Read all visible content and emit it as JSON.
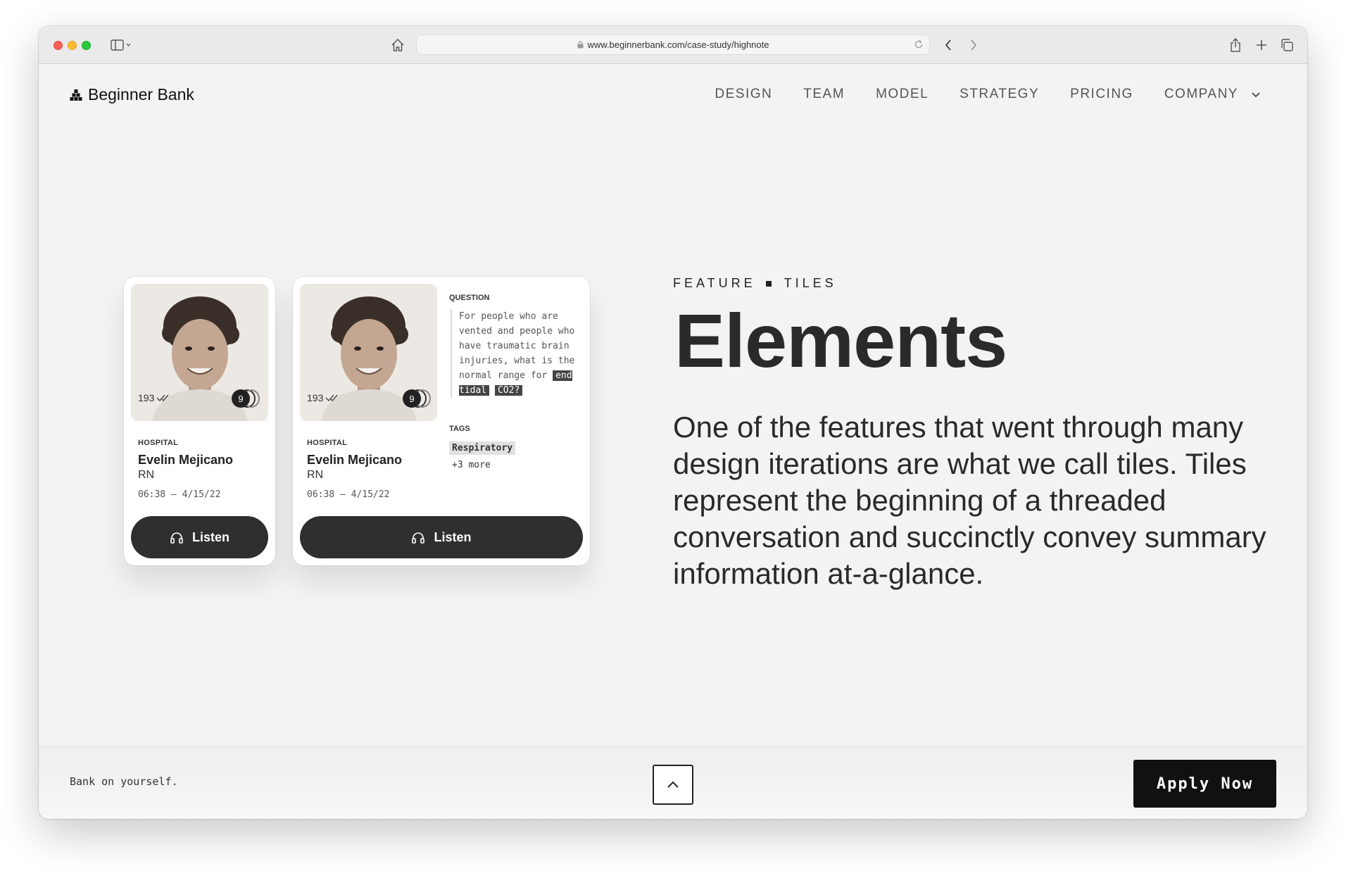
{
  "browser": {
    "url": "www.beginnerbank.com/case-study/highnote"
  },
  "nav": {
    "logo_text": "Beginner Bank",
    "items": [
      "DESIGN",
      "TEAM",
      "MODEL",
      "STRATEGY",
      "PRICING",
      "COMPANY"
    ]
  },
  "tiles": [
    {
      "count": "193",
      "badge": "9",
      "category": "HOSPITAL",
      "name": "Evelin Mejicano",
      "role": "RN",
      "time": "06:38 – 4/15/22",
      "button": "Listen"
    },
    {
      "count": "193",
      "badge": "9",
      "category": "HOSPITAL",
      "name": "Evelin Mejicano",
      "role": "RN",
      "time": "06:38 – 4/15/22",
      "button": "Listen",
      "question_label": "QUESTION",
      "question_text": "For people who are vented and people who have traumatic brain injuries, what is the normal range for",
      "question_highlight_1": "end tidal",
      "question_highlight_2": "CO2?",
      "tags_label": "TAGS",
      "tag": "Respiratory",
      "more": "+3 more"
    }
  ],
  "feature": {
    "eyebrow_1": "FEATURE",
    "eyebrow_2": "TILES",
    "headline": "Elements",
    "body": "One of the features that went through many design iterations are what we call tiles. Tiles represent the beginning of a threaded conversation and succinctly convey summary information at-a-glance."
  },
  "footer": {
    "tagline": "Bank on yourself.",
    "cta": "Apply Now"
  },
  "icons": {
    "back": "chevron-left-icon",
    "forward": "chevron-right-icon",
    "home": "home-icon",
    "share": "share-icon",
    "new_tab": "plus-icon",
    "tabs": "tabs-icon",
    "sidebar": "sidebar-icon",
    "listen": "headphones-icon",
    "scroll_top": "chevron-up-icon"
  }
}
